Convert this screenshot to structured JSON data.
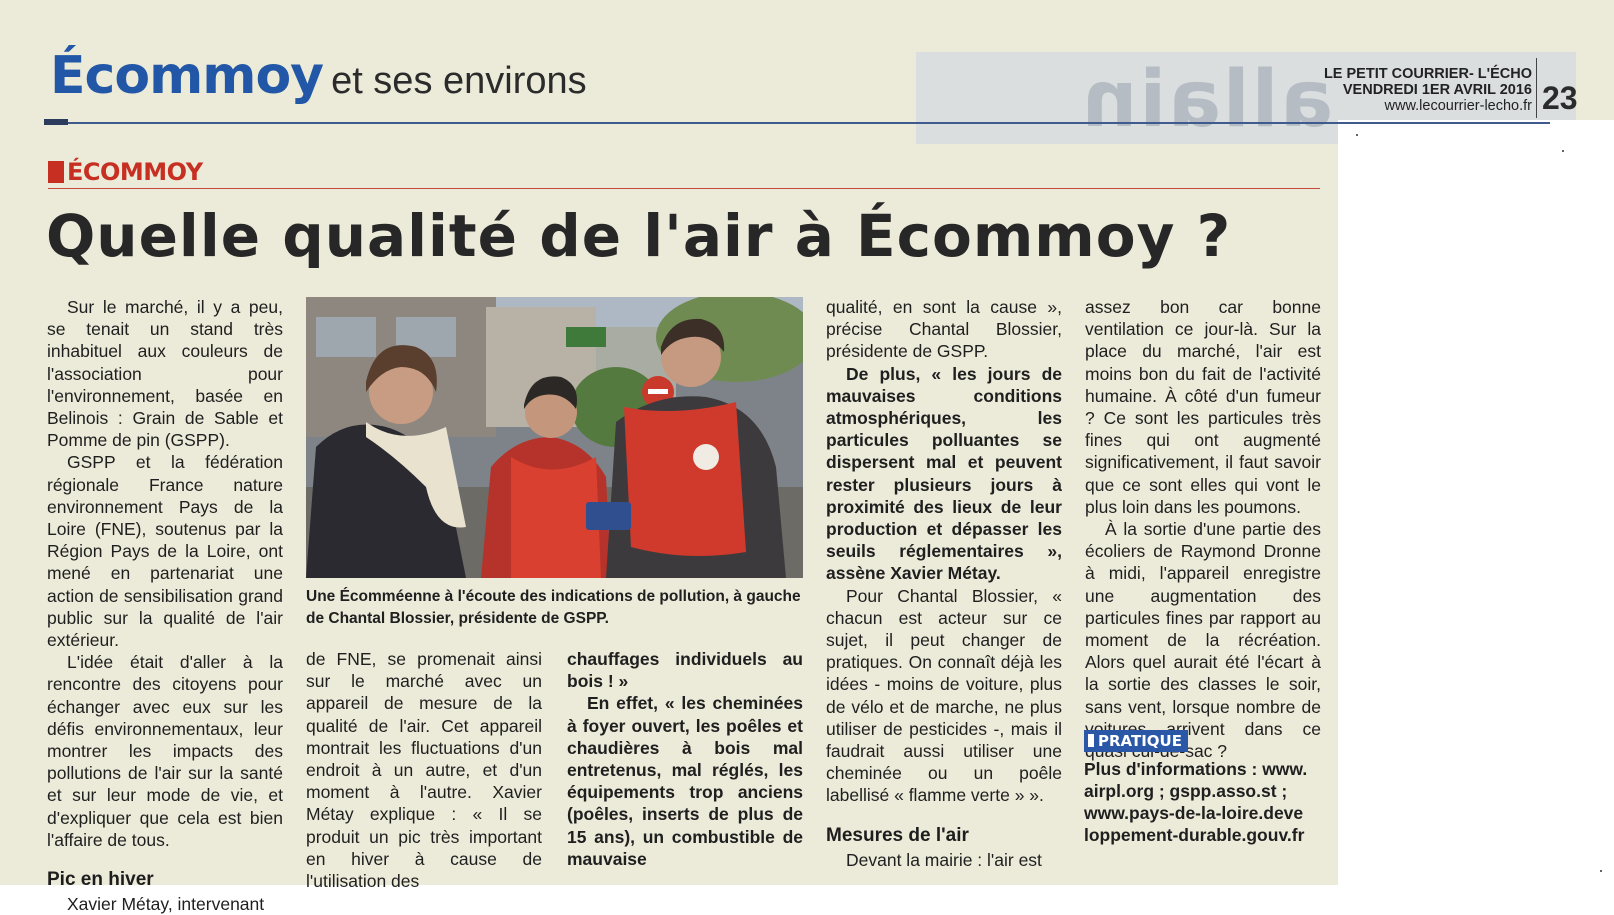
{
  "header": {
    "title": "Écommoy",
    "subtitle": "et ses environs",
    "publication": "LE PETIT COURRIER- L'ÉCHO",
    "date": "VENDREDI 1ER AVRIL 2016",
    "website": "www.lecourrier-lecho.fr",
    "page_number": "23"
  },
  "article": {
    "section": "ÉCOMMOY",
    "headline": "Quelle qualité de l'air à Écommoy ?",
    "col1": {
      "p1": "Sur le marché, il y a peu, se tenait un stand très inhabituel aux couleurs de l'association pour l'environnement, basée en Belinois : Grain de Sable et Pomme de pin (GSPP).",
      "p2": "GSPP et la fédération régionale France nature environnement Pays de la Loire (FNE), soutenus par la Région Pays de la Loire, ont mené en partenariat une action de sensibilisation grand public sur la qualité de l'air extérieur.",
      "p3": "L'idée était d'aller à la rencontre des citoyens pour échanger avec eux sur les défis environnementaux, leur montrer les impacts des pollutions de l'air sur la santé et sur leur mode de vie, et d'expliquer que cela est bien l'affaire de tous.",
      "subhead": "Pic en hiver",
      "p4": "Xavier Métay, intervenant"
    },
    "col2": {
      "p1": "de FNE, se promenait ainsi sur le marché avec un appareil de mesure de la qualité de l'air. Cet appareil montrait les fluctuations d'un endroit à un autre, et d'un moment à l'autre. Xavier Métay explique : « Il se produit un pic très important en hiver à cause de l'utilisation des"
    },
    "col3": {
      "p1": "chauffages individuels au bois ! »",
      "p2": "En effet, « les cheminées à foyer ouvert, les poêles et chaudières à bois mal entretenus, mal réglés, les équipements trop anciens (poêles, inserts de plus de 15 ans), un combustible de mauvaise"
    },
    "col4": {
      "p1": "qualité, en sont la cause », précise Chantal Blossier, présidente de GSPP.",
      "p2": "De plus, « les jours de mauvaises conditions atmosphériques, les particules polluantes se dispersent mal et peuvent rester plusieurs jours à proximité des lieux de leur production et dépasser les seuils réglementaires », assène Xavier Métay.",
      "p3": "Pour Chantal Blossier, « chacun est acteur sur ce sujet, il peut changer de pratiques. On connaît déjà les idées - moins de voiture, plus de vélo et de marche, ne plus utiliser de pesticides -, mais il faudrait aussi utiliser une cheminée ou un poêle labellisé « flamme verte » ».",
      "subhead": "Mesures de l'air",
      "p4": "Devant la mairie : l'air est"
    },
    "col5": {
      "p1": "assez bon car bonne ventilation ce jour-là. Sur la place du marché, l'air est moins bon du fait de l'activité humaine. À côté d'un fumeur ? Ce sont les particules très fines qui ont augmenté significativement, il faut savoir que ce sont elles qui vont le plus loin dans les poumons.",
      "p2": "À la sortie d'une partie des écoliers de Raymond Dronne à midi, l'appareil enregistre une augmentation des particules fines par rapport au moment de la récréation. Alors quel aurait été l'écart à la sortie des classes le soir, sans vent, lorsque nombre de voitures arrivent dans ce quasi cul-de-sac ?"
    },
    "photo_caption": "Une Écomméenne à l'écoute des indications de pollution, à gauche de Chantal Blossier, présidente de GSPP.",
    "practical": {
      "label": "PRATIQUE",
      "line1": "Plus d'informations : www.",
      "line2": "airpl.org ; gspp.asso.st ;",
      "line3": "www.pays-de-la-loire.deve",
      "line4": "loppement-durable.gouv.fr"
    }
  },
  "colors": {
    "title_blue": "#2157a6",
    "section_red": "#c62f22",
    "paper": "#ecead9",
    "pratique_bg": "#2a58a6"
  }
}
